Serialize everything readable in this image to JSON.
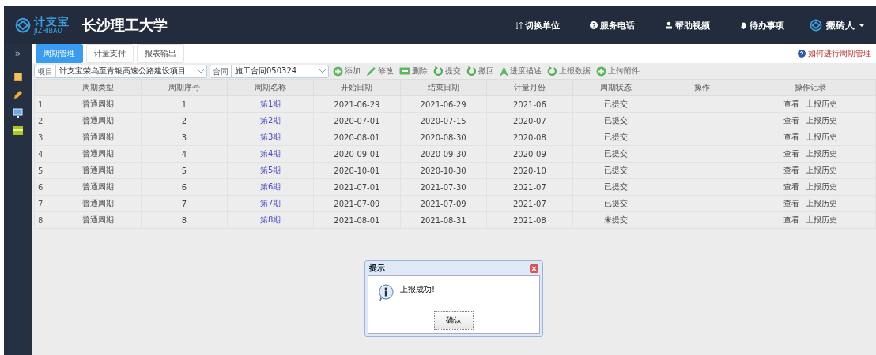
{
  "header": {
    "logo_text": "计支宝",
    "logo_sub": "JIZHIBAO",
    "title": "长沙理工大学",
    "nav": [
      "切换单位",
      "服务电话",
      "帮助视频",
      "待办事项"
    ],
    "user": "搬砖人"
  },
  "sidebar": {
    "toggle": "»"
  },
  "tabs": [
    {
      "label": "周期管理",
      "selected": true
    },
    {
      "label": "计量支付",
      "selected": false
    },
    {
      "label": "报表输出",
      "selected": false
    }
  ],
  "help_link": "如何进行周期管理",
  "filters": [
    {
      "label": "项目",
      "value": "计支宝荣乌至青银高速公路建设项目"
    },
    {
      "label": "合同",
      "value": "施工合同050324"
    }
  ],
  "toolbar": [
    "添加",
    "修改",
    "删除",
    "提交",
    "撤回",
    "进度描述",
    "上报数据",
    "上传附件"
  ],
  "table": {
    "columns": [
      "周期类型",
      "周期序号",
      "周期名称",
      "开始日期",
      "结束日期",
      "计量月份",
      "周期状态",
      "操作",
      "操作记录"
    ],
    "rows": [
      {
        "index": "1",
        "type": "普通周期",
        "seq": "1",
        "name": "第1期",
        "start": "2021-06-29",
        "end": "2021-06-29",
        "month": "2021-06",
        "status": "已提交",
        "links": [
          "查看",
          "上报历史"
        ]
      },
      {
        "index": "2",
        "type": "普通周期",
        "seq": "2",
        "name": "第2期",
        "start": "2020-07-01",
        "end": "2020-07-15",
        "month": "2020-07",
        "status": "已提交",
        "links": [
          "查看",
          "上报历史"
        ]
      },
      {
        "index": "3",
        "type": "普通周期",
        "seq": "3",
        "name": "第3期",
        "start": "2020-08-01",
        "end": "2020-08-30",
        "month": "2020-08",
        "status": "已提交",
        "links": [
          "查看",
          "上报历史"
        ]
      },
      {
        "index": "4",
        "type": "普通周期",
        "seq": "4",
        "name": "第4期",
        "start": "2020-09-01",
        "end": "2020-09-30",
        "month": "2020-09",
        "status": "已提交",
        "links": [
          "查看",
          "上报历史"
        ]
      },
      {
        "index": "5",
        "type": "普通周期",
        "seq": "5",
        "name": "第5期",
        "start": "2020-10-01",
        "end": "2020-10-30",
        "month": "2020-10",
        "status": "已提交",
        "links": [
          "查看",
          "上报历史"
        ]
      },
      {
        "index": "6",
        "type": "普通周期",
        "seq": "6",
        "name": "第6期",
        "start": "2021-07-01",
        "end": "2021-07-30",
        "month": "2021-07",
        "status": "已提交",
        "links": [
          "查看",
          "上报历史"
        ]
      },
      {
        "index": "7",
        "type": "普通周期",
        "seq": "7",
        "name": "第7期",
        "start": "2021-07-09",
        "end": "2021-07-09",
        "month": "2021-07",
        "status": "已提交",
        "links": [
          "查看",
          "上报历史"
        ]
      },
      {
        "index": "8",
        "type": "普通周期",
        "seq": "8",
        "name": "第8期",
        "start": "2021-08-01",
        "end": "2021-08-31",
        "month": "2021-08",
        "status": "未提交",
        "links": [
          "查看",
          "上报历史"
        ]
      }
    ]
  },
  "dialog": {
    "title": "提示",
    "message": "上报成功!",
    "button": "确认"
  }
}
